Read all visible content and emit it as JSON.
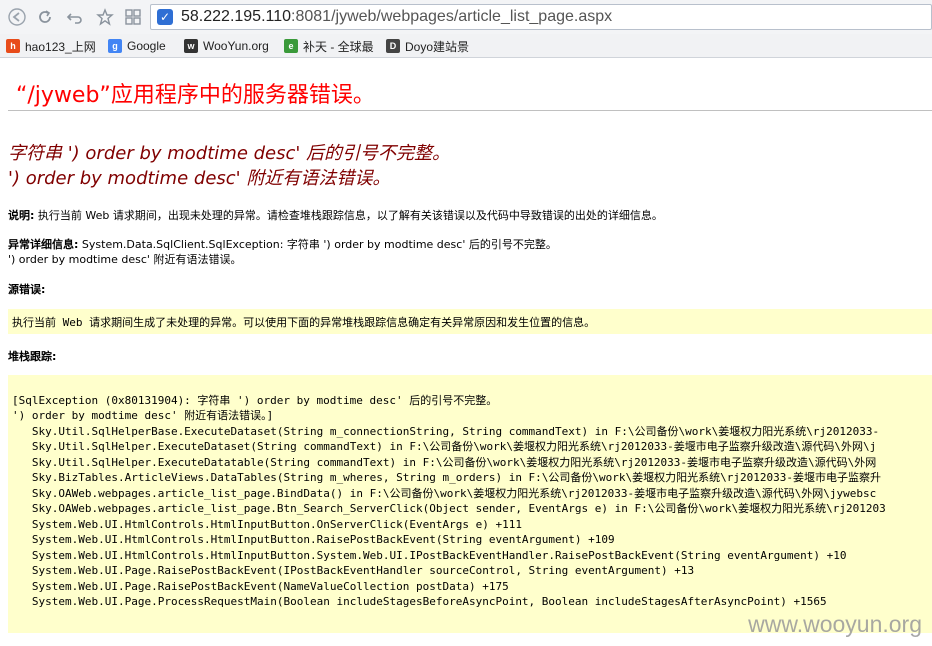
{
  "browser": {
    "url_host": "58.222.195.110",
    "url_rest": ":8081/jyweb/webpages/article_list_page.aspx",
    "bookmarks": [
      {
        "label": "hao123_上网",
        "icon": "hao123-icon",
        "color": "#e84c1a"
      },
      {
        "label": "Google",
        "icon": "google-icon",
        "color": "#4285f4"
      },
      {
        "label": "WooYun.org",
        "icon": "wooyun-icon",
        "color": "#333333"
      },
      {
        "label": "补天 - 全球最",
        "icon": "butian-icon",
        "color": "#3a9a3a"
      },
      {
        "label": "Doyo建站景",
        "icon": "doyo-icon",
        "color": "#444444"
      }
    ]
  },
  "page": {
    "title": "“/jyweb”应用程序中的服务器错误。",
    "error_line1": "字符串 ') order by modtime desc' 后的引号不完整。",
    "error_line2": "') order by modtime desc' 附近有语法错误。",
    "description_label": "说明:",
    "description_text": " 执行当前 Web 请求期间，出现未处理的异常。请检查堆栈跟踪信息，以了解有关该错误以及代码中导致错误的出处的详细信息。",
    "exception_label": "异常详细信息:",
    "exception_text": " System.Data.SqlClient.SqlException: 字符串 ') order by modtime desc' 后的引号不完整。",
    "exception_text2": "') order by modtime desc' 附近有语法错误。",
    "source_label": "源错误:",
    "source_text": "执行当前 Web 请求期间生成了未处理的异常。可以使用下面的异常堆栈跟踪信息确定有关异常原因和发生位置的信息。",
    "stack_label": "堆栈跟踪:",
    "stack_lines": [
      "[SqlException (0x80131904): 字符串 ') order by modtime desc' 后的引号不完整。",
      "') order by modtime desc' 附近有语法错误。]",
      "   Sky.Util.SqlHelperBase.ExecuteDataset(String m_connectionString, String commandText) in F:\\公司备份\\work\\姜堰权力阳光系统\\rj2012033-",
      "   Sky.Util.SqlHelper.ExecuteDataset(String commandText) in F:\\公司备份\\work\\姜堰权力阳光系统\\rj2012033-姜堰市电子监察升级改造\\源代码\\外网\\j",
      "   Sky.Util.SqlHelper.ExecuteDatatable(String commandText) in F:\\公司备份\\work\\姜堰权力阳光系统\\rj2012033-姜堰市电子监察升级改造\\源代码\\外网",
      "   Sky.BizTables.ArticleViews.DataTables(String m_wheres, String m_orders) in F:\\公司备份\\work\\姜堰权力阳光系统\\rj2012033-姜堰市电子监察升",
      "   Sky.OAWeb.webpages.article_list_page.BindData() in F:\\公司备份\\work\\姜堰权力阳光系统\\rj2012033-姜堰市电子监察升级改造\\源代码\\外网\\jywebsc",
      "   Sky.OAWeb.webpages.article_list_page.Btn_Search_ServerClick(Object sender, EventArgs e) in F:\\公司备份\\work\\姜堰权力阳光系统\\rj201203",
      "   System.Web.UI.HtmlControls.HtmlInputButton.OnServerClick(EventArgs e) +111",
      "   System.Web.UI.HtmlControls.HtmlInputButton.RaisePostBackEvent(String eventArgument) +109",
      "   System.Web.UI.HtmlControls.HtmlInputButton.System.Web.UI.IPostBackEventHandler.RaisePostBackEvent(String eventArgument) +10",
      "   System.Web.UI.Page.RaisePostBackEvent(IPostBackEventHandler sourceControl, String eventArgument) +13",
      "   System.Web.UI.Page.RaisePostBackEvent(NameValueCollection postData) +175",
      "   System.Web.UI.Page.ProcessRequestMain(Boolean includeStagesBeforeAsyncPoint, Boolean includeStagesAfterAsyncPoint) +1565"
    ],
    "watermark": "www.wooyun.org"
  }
}
